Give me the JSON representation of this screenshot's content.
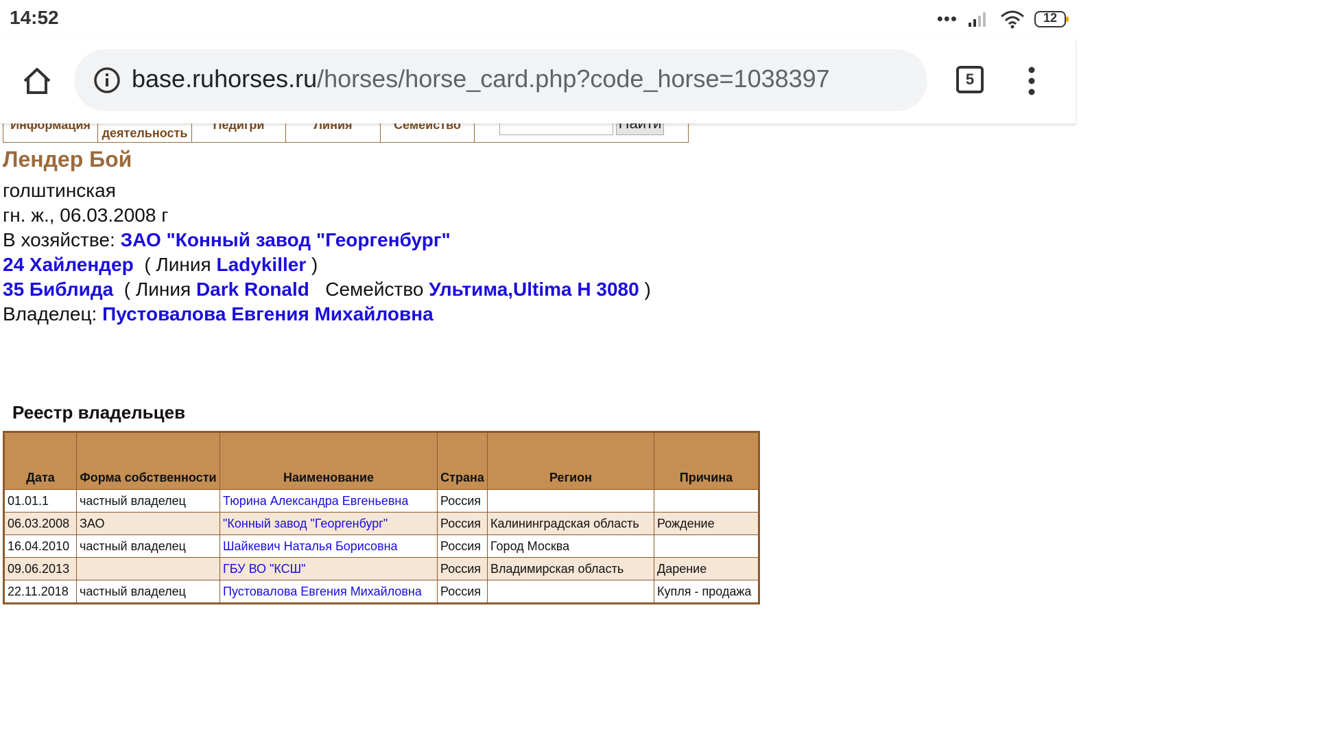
{
  "status_bar": {
    "time": "14:52",
    "battery": "12"
  },
  "browser": {
    "url_host": "base.ruhorses.ru",
    "url_path": "/horses/horse_card.php?code_horse=1038397",
    "tabs_count": "5"
  },
  "nav": {
    "cell1": "Информация",
    "cell2": "деятельность",
    "cell3": "Педигри",
    "cell4": "Линия",
    "cell5": "Семейство",
    "search_button": "Найти"
  },
  "horse": {
    "name": "Лендер Бой",
    "breed": "голштинская",
    "details": "гн. ж., 06.03.2008 г",
    "farm_label": "В хозяйстве:",
    "farm": "ЗАО \"Конный завод \"Георгенбург\"",
    "sire": "24 Хайлендер",
    "sire_line_label": "( Линия",
    "sire_line": "Ladykiller",
    "close1": ")",
    "dam": "35 Библида",
    "dam_line_label": "( Линия",
    "dam_line": "Dark Ronald",
    "family_label": "Семейство",
    "family": "Ультима,Ultima H 3080",
    "close2": ")",
    "owner_label": "Владелец:",
    "owner": "Пустовалова Евгения Михайловна"
  },
  "registry": {
    "title": "Реестр владельцев",
    "headers": [
      "Дата",
      "Форма собственности",
      "Наименование",
      "Страна",
      "Регион",
      "Причина"
    ],
    "rows": [
      [
        "01.01.1",
        "частный владелец",
        "Тюрина Александра Евгеньевна",
        "Россия",
        "",
        ""
      ],
      [
        "06.03.2008",
        "ЗАО",
        "\"Конный завод \"Георгенбург\"",
        "Россия",
        "Калининградская область",
        "Рождение"
      ],
      [
        "16.04.2010",
        "частный владелец",
        "Шайкевич Наталья Борисовна",
        "Россия",
        "Город Москва",
        ""
      ],
      [
        "09.06.2013",
        "",
        "ГБУ ВО \"КСШ\"",
        "Россия",
        "Владимирская область",
        "Дарение"
      ],
      [
        "22.11.2018",
        "частный владелец",
        "Пустовалова Евгения Михайловна",
        "Россия",
        "",
        "Купля - продажа"
      ]
    ]
  }
}
